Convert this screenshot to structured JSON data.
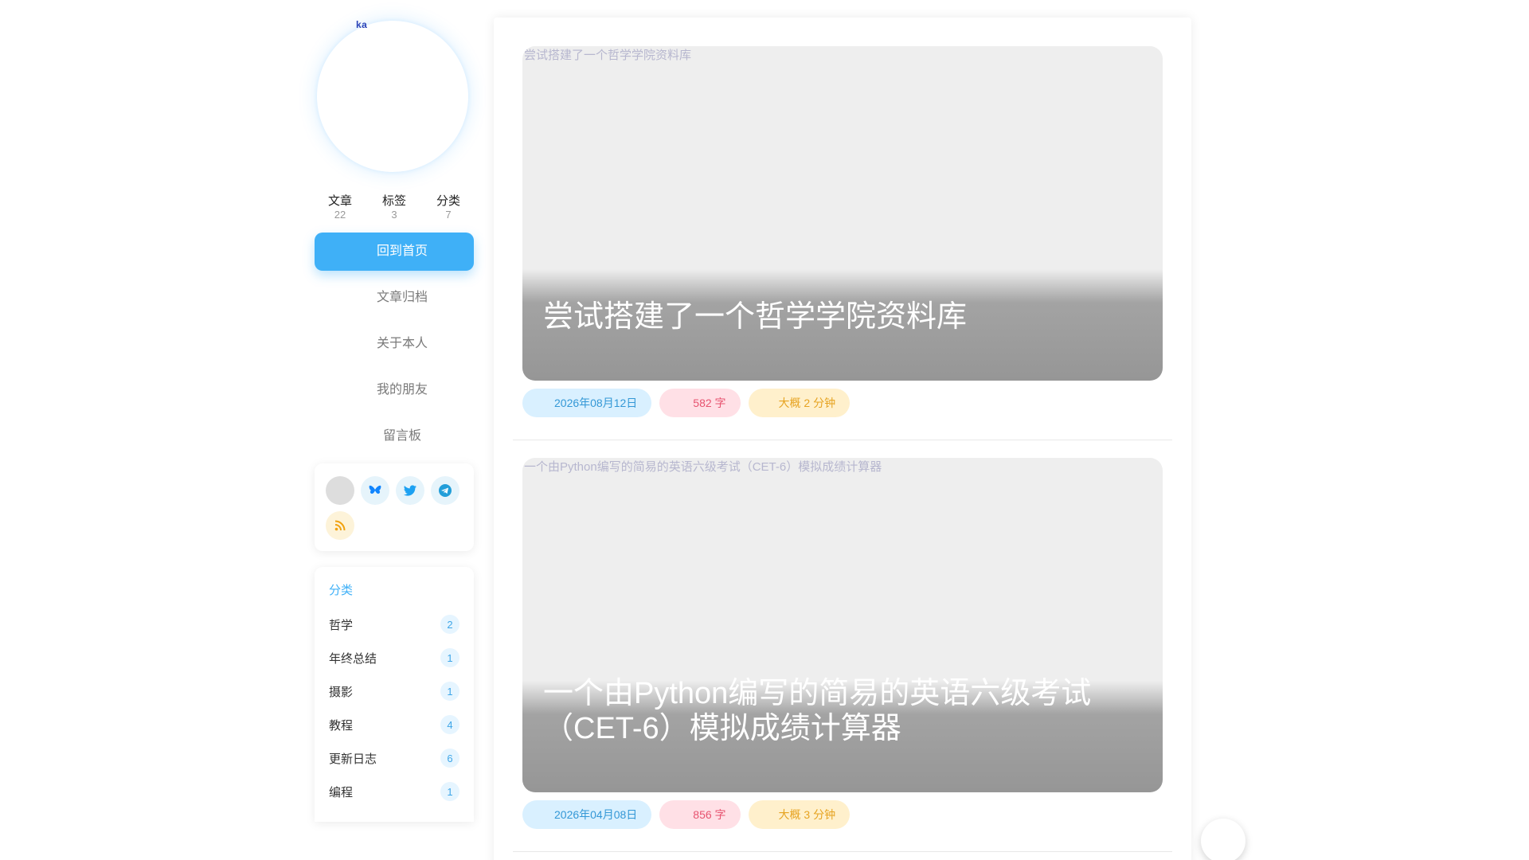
{
  "sidebar": {
    "avatar_alt": "ka",
    "stats": [
      {
        "label": "文章",
        "value": "22"
      },
      {
        "label": "标签",
        "value": "3"
      },
      {
        "label": "分类",
        "value": "7"
      }
    ],
    "nav": [
      {
        "label": "回到首页",
        "active": true
      },
      {
        "label": "文章归档",
        "active": false
      },
      {
        "label": "关于本人",
        "active": false
      },
      {
        "label": "我的朋友",
        "active": false
      },
      {
        "label": "留言板",
        "active": false
      }
    ],
    "social": [
      {
        "icon": "blank-circle-icon",
        "color": "#dddddd"
      },
      {
        "icon": "bluesky-butterfly-icon",
        "color": "#1185fe"
      },
      {
        "icon": "twitter-bird-icon",
        "color": "#1da1f2"
      },
      {
        "icon": "telegram-plane-icon",
        "color": "#229ed9"
      },
      {
        "icon": "rss-icon",
        "color": "#f1a20f"
      }
    ],
    "categories": {
      "title": "分类",
      "items": [
        {
          "label": "哲学",
          "count": "2"
        },
        {
          "label": "年终总结",
          "count": "1"
        },
        {
          "label": "摄影",
          "count": "1"
        },
        {
          "label": "教程",
          "count": "4"
        },
        {
          "label": "更新日志",
          "count": "6"
        },
        {
          "label": "编程",
          "count": "1"
        }
      ]
    }
  },
  "posts": [
    {
      "cover_alt": "尝试搭建了一个哲学学院资料库",
      "title": "尝试搭建了一个哲学学院资料库",
      "date": "2026年08月12日",
      "words": "582 字",
      "reading": "大概 2 分钟"
    },
    {
      "cover_alt": "一个由Python编写的简易的英语六级考试（CET-6）模拟成绩计算器",
      "title": "一个由Python编写的简易的英语六级考试（CET-6）模拟成绩计算器",
      "date": "2026年04月08日",
      "words": "856 字",
      "reading": "大概 3 分钟"
    }
  ],
  "colors": {
    "accent": "#3fb0f7",
    "date_badge": "#d9f0ff",
    "words_badge": "#ffe0e6",
    "time_badge": "#fff0cc"
  }
}
